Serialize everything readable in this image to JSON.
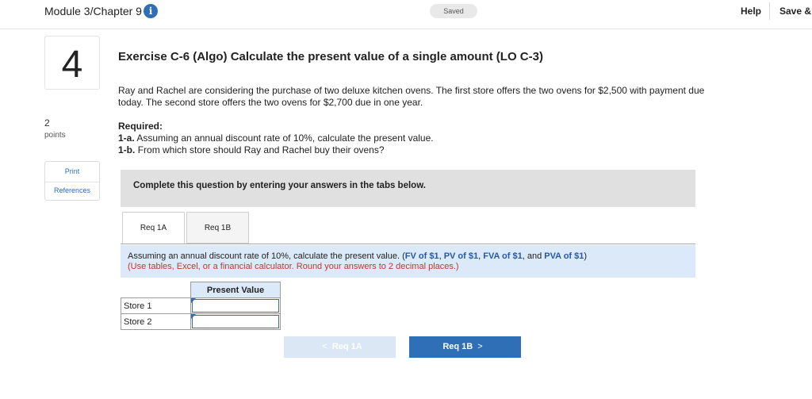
{
  "header": {
    "module_title": "Module 3/Chapter 9",
    "info_glyph": "i",
    "saved_label": "Saved",
    "help_label": "Help",
    "save_label": "Save & E"
  },
  "question": {
    "number": "4",
    "points_value": "2",
    "points_label": "points",
    "print_label": "Print",
    "references_label": "References"
  },
  "exercise": {
    "title": "Exercise C-6 (Algo) Calculate the present value of a single amount (LO C-3)",
    "intro": "Ray and Rachel are considering the purchase of two deluxe kitchen ovens. The first store offers the two ovens for $2,500 with payment due today. The second store offers the two ovens for $2,700 due in one year.",
    "required_label": "Required:",
    "req_1a_tag": "1-a.",
    "req_1a_text": "Assuming an annual discount rate of 10%, calculate the present value.",
    "req_1b_tag": "1-b.",
    "req_1b_text": "From which store should Ray and Rachel buy their ovens?"
  },
  "instructions": "Complete this question by entering your answers in the tabs below.",
  "tabs": [
    {
      "label": "Req 1A",
      "active": true
    },
    {
      "label": "Req 1B",
      "active": false
    }
  ],
  "panel": {
    "text_start": "Assuming an annual discount rate of 10%, calculate the present value. (",
    "link_fv": "FV of $1",
    "sep1": ", ",
    "link_pv": "PV of $1",
    "sep2": ", ",
    "link_fva": "FVA of $1",
    "sep3": ", and ",
    "link_pva": "PVA of $1",
    "text_end": ")",
    "note": "(Use tables, Excel, or a financial calculator. Round your answers to 2 decimal places.)"
  },
  "table": {
    "header": "Present Value",
    "rows": [
      {
        "label": "Store 1",
        "value": ""
      },
      {
        "label": "Store 2",
        "value": ""
      }
    ]
  },
  "nav": {
    "prev_label": "Req 1A",
    "next_label": "Req 1B",
    "prev_glyph": "<",
    "next_glyph": ">"
  },
  "colors": {
    "accent": "#2f6fb6",
    "panel_bg": "#dce9f8",
    "instruction_bg": "#e0e0e0",
    "note_red": "#c0392b"
  }
}
